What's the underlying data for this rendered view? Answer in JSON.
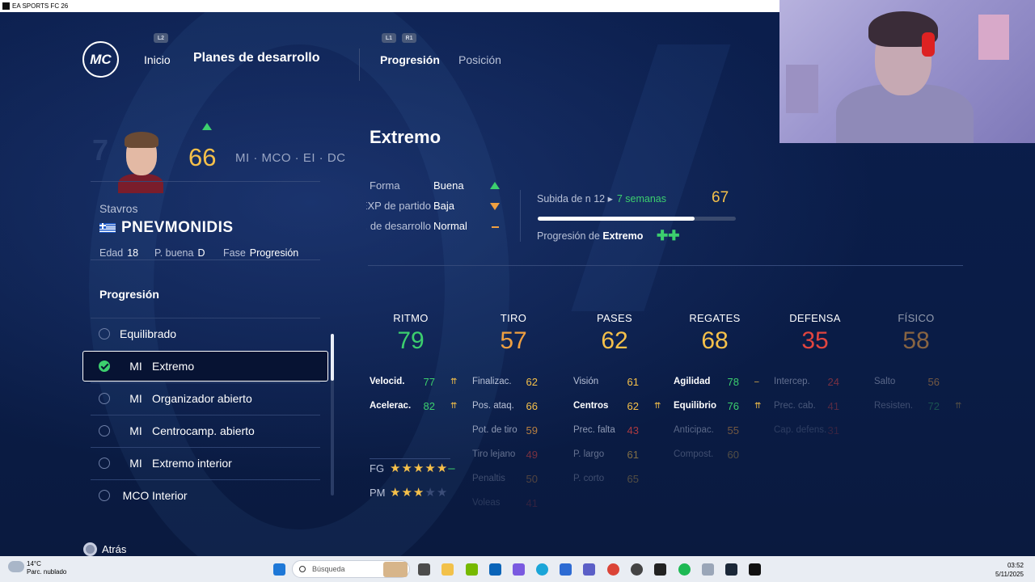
{
  "window": {
    "title": "EA SPORTS FC 26"
  },
  "nav": {
    "logo_text": "MC",
    "l2": "L2",
    "inicio": "Inicio",
    "title": "Planes de desarrollo",
    "l1": "L1",
    "r1": "R1",
    "tab_progresion": "Progresión",
    "tab_posicion": "Posición"
  },
  "player": {
    "ovr": "66",
    "positions": "MI · MCO · EI · DC",
    "first_name": "Stavros",
    "last_name": "PNEVMONIDIS",
    "edad_label": "Edad",
    "edad": "18",
    "pbuena_label": "P. buena",
    "pbuena": "D",
    "fase_label": "Fase",
    "fase": "Progresión"
  },
  "progression": {
    "title": "Progresión",
    "roles": [
      {
        "pos": "",
        "name": "Equilibrado"
      },
      {
        "pos": "MI",
        "name": "Extremo"
      },
      {
        "pos": "MI",
        "name": "Organizador abierto"
      },
      {
        "pos": "MI",
        "name": "Centrocamp. abierto"
      },
      {
        "pos": "MI",
        "name": "Extremo interior"
      },
      {
        "pos": "MCO",
        "name": "Interior"
      }
    ],
    "selected_index": 1
  },
  "back": "Atrás",
  "detail": {
    "role_title": "Extremo",
    "forma_label": "Forma",
    "forma": "Buena",
    "exp_label": "EXP de partido",
    "exp": "Baja",
    "bonif_label": "Bonif. de desarrollo",
    "bonif": "Normal",
    "subida_label": "Subida de n 12 ▸",
    "subida_time": "7 semanas",
    "subida_value": "67",
    "subida_progress": 0.79,
    "prog_label": "Progresión de",
    "prog_role": "Extremo",
    "plus": "✚✚"
  },
  "categories": [
    {
      "label": "RITMO",
      "value": "79",
      "color": "#3ccf6e",
      "opacity": 1
    },
    {
      "label": "TIRO",
      "value": "57",
      "color": "#f0a040",
      "opacity": 1
    },
    {
      "label": "PASES",
      "value": "62",
      "color": "#f5c04a",
      "opacity": 1
    },
    {
      "label": "REGATES",
      "value": "68",
      "color": "#f5c04a",
      "opacity": 1
    },
    {
      "label": "DEFENSA",
      "value": "35",
      "color": "#e2453f",
      "opacity": 1
    },
    {
      "label": "FÍSICO",
      "value": "58",
      "color": "#f0a040",
      "opacity": 0.55
    }
  ],
  "substats": [
    [
      {
        "label": "Velocid.",
        "value": "77",
        "mod": "⇈",
        "bold": true
      },
      {
        "label": "Acelerac.",
        "value": "82",
        "mod": "⇈",
        "bold": true
      }
    ],
    [
      {
        "label": "Finalizac.",
        "value": "62",
        "mod": ""
      },
      {
        "label": "Pos. ataq.",
        "value": "66",
        "mod": ""
      },
      {
        "label": "Pot. de tiro",
        "value": "59",
        "mod": ""
      },
      {
        "label": "Tiro lejano",
        "value": "49",
        "mod": ""
      },
      {
        "label": "Penaltis",
        "value": "50",
        "mod": ""
      },
      {
        "label": "Voleas",
        "value": "41",
        "mod": ""
      }
    ],
    [
      {
        "label": "Visión",
        "value": "61",
        "mod": ""
      },
      {
        "label": "Centros",
        "value": "62",
        "mod": "⇈",
        "bold": true
      },
      {
        "label": "Prec. falta",
        "value": "43",
        "mod": ""
      },
      {
        "label": "P. largo",
        "value": "61",
        "mod": ""
      },
      {
        "label": "P. corto",
        "value": "65",
        "mod": ""
      }
    ],
    [
      {
        "label": "Agilidad",
        "value": "78",
        "mod": "–",
        "bold": true
      },
      {
        "label": "Equilibrio",
        "value": "76",
        "mod": "⇈",
        "bold": true
      },
      {
        "label": "Anticipac.",
        "value": "55",
        "mod": ""
      },
      {
        "label": "Compost.",
        "value": "60",
        "mod": ""
      }
    ],
    [
      {
        "label": "Intercep.",
        "value": "24",
        "mod": ""
      },
      {
        "label": "Prec. cab.",
        "value": "41",
        "mod": ""
      },
      {
        "label": "Cap. defens.",
        "value": "31",
        "mod": ""
      }
    ],
    [
      {
        "label": "Salto",
        "value": "56",
        "mod": ""
      },
      {
        "label": "Resisten.",
        "value": "72",
        "mod": "⇈"
      }
    ]
  ],
  "ratings": {
    "fg_label": "FG",
    "fg_stars": 5,
    "fg_suffix": "–",
    "pm_label": "PM",
    "pm_stars": 3
  },
  "taskbar": {
    "temp": "14°C",
    "weather": "Parc. nublado",
    "search_placeholder": "Búsqueda",
    "time": "03:52",
    "date": "5/11/2025"
  }
}
